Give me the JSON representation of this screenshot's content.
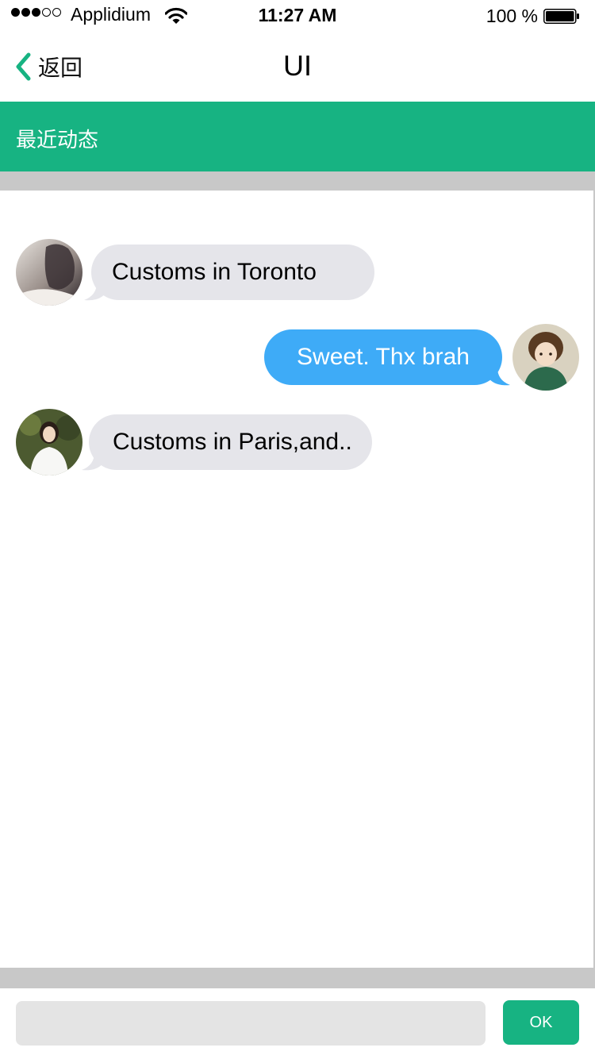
{
  "status_bar": {
    "carrier": "Applidium",
    "time": "11:27 AM",
    "battery_percent": "100 %",
    "battery_level": 1.0
  },
  "nav": {
    "back_label": "返回",
    "title": "UI"
  },
  "section": {
    "title": "最近动态"
  },
  "messages": [
    {
      "direction": "incoming",
      "text": "Customs in Toronto"
    },
    {
      "direction": "outgoing",
      "text": "Sweet. Thx brah"
    },
    {
      "direction": "incoming",
      "text": "Customs in Paris,and.."
    }
  ],
  "input": {
    "value": "",
    "placeholder": "",
    "send_label": "OK"
  },
  "colors": {
    "accent_green": "#17b382",
    "outgoing_bubble": "#3eabf7",
    "incoming_bubble": "#e5e5ea",
    "separator_gray": "#c8c8c8"
  },
  "icons": [
    "signal-dots-icon",
    "wifi-icon",
    "battery-icon",
    "back-chevron-icon"
  ]
}
